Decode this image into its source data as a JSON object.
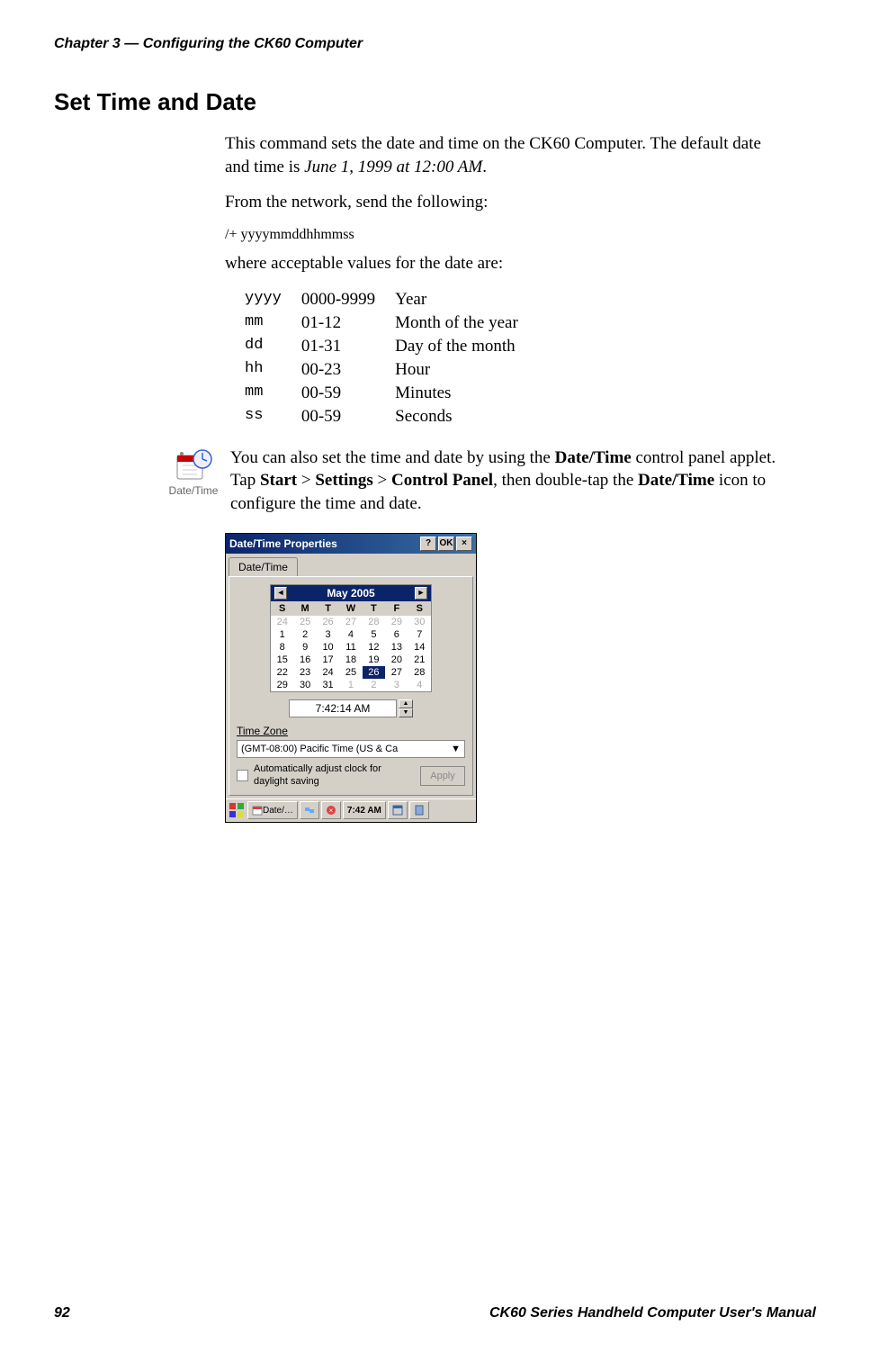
{
  "header": "Chapter 3 — Configuring the CK60 Computer",
  "section_title": "Set Time and Date",
  "para1_a": "This command sets the date and time on the CK60 Computer. The default date and time is ",
  "para1_b": "June 1, 1999 at 12:00 AM",
  "para1_c": ".",
  "para2": "From the network, send the following:",
  "code_line": "/+ yyyymmddhhmmss",
  "para3": "where acceptable values for the date are:",
  "values": [
    {
      "code": "yyyy",
      "range": "0000-9999",
      "desc": "Year"
    },
    {
      "code": "mm",
      "range": "01-12",
      "desc": "Month of the year"
    },
    {
      "code": "dd",
      "range": "01-31",
      "desc": "Day of the month"
    },
    {
      "code": "hh",
      "range": "00-23",
      "desc": "Hour"
    },
    {
      "code": "mm",
      "range": "00-59",
      "desc": "Minutes"
    },
    {
      "code": "ss",
      "range": "00-59",
      "desc": "Seconds"
    }
  ],
  "icon_label": "Date/Time",
  "icon_para_a": "You can also set the time and date by using the ",
  "icon_para_b": "Date/Time",
  "icon_para_c": " control panel applet. Tap ",
  "icon_para_d": "Start",
  "icon_para_e": " > ",
  "icon_para_f": "Settings",
  "icon_para_g": " > ",
  "icon_para_h": "Control Panel",
  "icon_para_i": ", then double-tap the ",
  "icon_para_j": "Date/Time",
  "icon_para_k": " icon to configure the time and date.",
  "dialog": {
    "title": "Date/Time Properties",
    "help": "?",
    "ok": "OK",
    "close": "×",
    "tab": "Date/Time",
    "month": "May 2005",
    "dow": [
      "S",
      "M",
      "T",
      "W",
      "T",
      "F",
      "S"
    ],
    "prev_days": [
      "24",
      "25",
      "26",
      "27",
      "28",
      "29",
      "30"
    ],
    "days_r1": [
      "1",
      "2",
      "3",
      "4",
      "5",
      "6",
      "7"
    ],
    "days_r2": [
      "8",
      "9",
      "10",
      "11",
      "12",
      "13",
      "14"
    ],
    "days_r3": [
      "15",
      "16",
      "17",
      "18",
      "19",
      "20",
      "21"
    ],
    "days_r4": [
      "22",
      "23",
      "24",
      "25",
      "26",
      "27",
      "28"
    ],
    "days_r5": [
      "29",
      "30",
      "31",
      "1",
      "2",
      "3",
      "4"
    ],
    "selected_day": "26",
    "time_value": "7:42:14 AM",
    "tz_label": "Time Zone",
    "tz_value": "(GMT-08:00) Pacific Time (US & Ca",
    "auto_label": "Automatically adjust clock for daylight saving",
    "apply": "Apply",
    "tb_app": "Date/…",
    "tb_time": "7:42 AM"
  },
  "footer_page": "92",
  "footer_title": "CK60 Series Handheld Computer User's Manual"
}
